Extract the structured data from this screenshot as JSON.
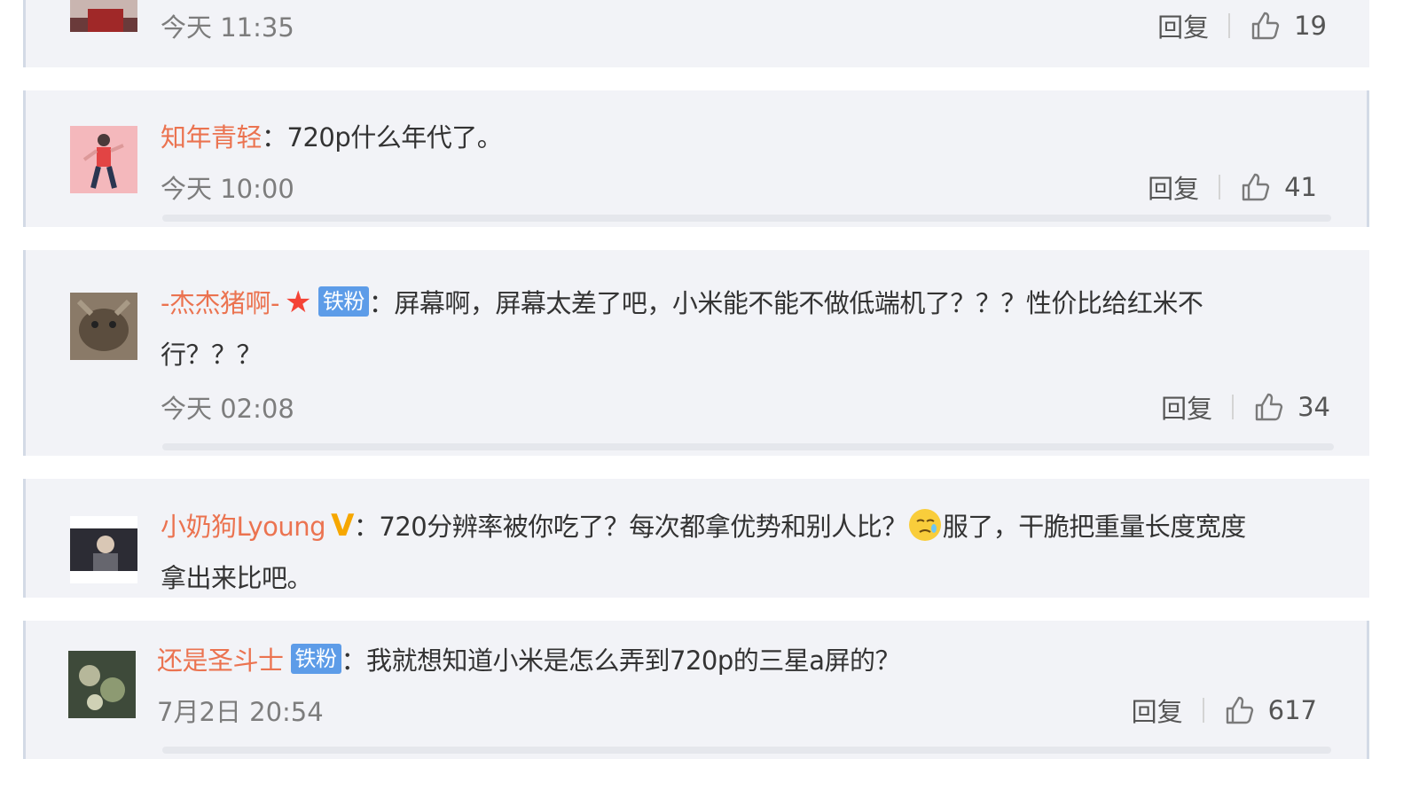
{
  "common": {
    "reply_label": "回复"
  },
  "comments": [
    {
      "username": "",
      "text": "",
      "time": "今天 11:35",
      "likes": "19"
    },
    {
      "username": "知年青轻",
      "text": "：720p什么年代了。",
      "time": "今天 10:00",
      "likes": "41"
    },
    {
      "username": "-杰杰猪啊-",
      "badge": "铁粉",
      "text": "：屏幕啊，屏幕太差了吧，小米能不能不做低端机了？？？性价比给红米不",
      "text2": "行？？？",
      "time": "今天 02:08",
      "likes": "34"
    },
    {
      "username": "小奶狗Lyoung",
      "text": "：720分辨率被你吃了？每次都拿优势和别人比？",
      "text_after_emoji": "服了，干脆把重量长度宽度",
      "text2": "拿出来比吧。"
    },
    {
      "username": "还是圣斗士",
      "badge": "铁粉",
      "text": "：我就想知道小米是怎么弄到720p的三星a屏的？",
      "time": "7月2日 20:54",
      "likes": "617"
    }
  ]
}
